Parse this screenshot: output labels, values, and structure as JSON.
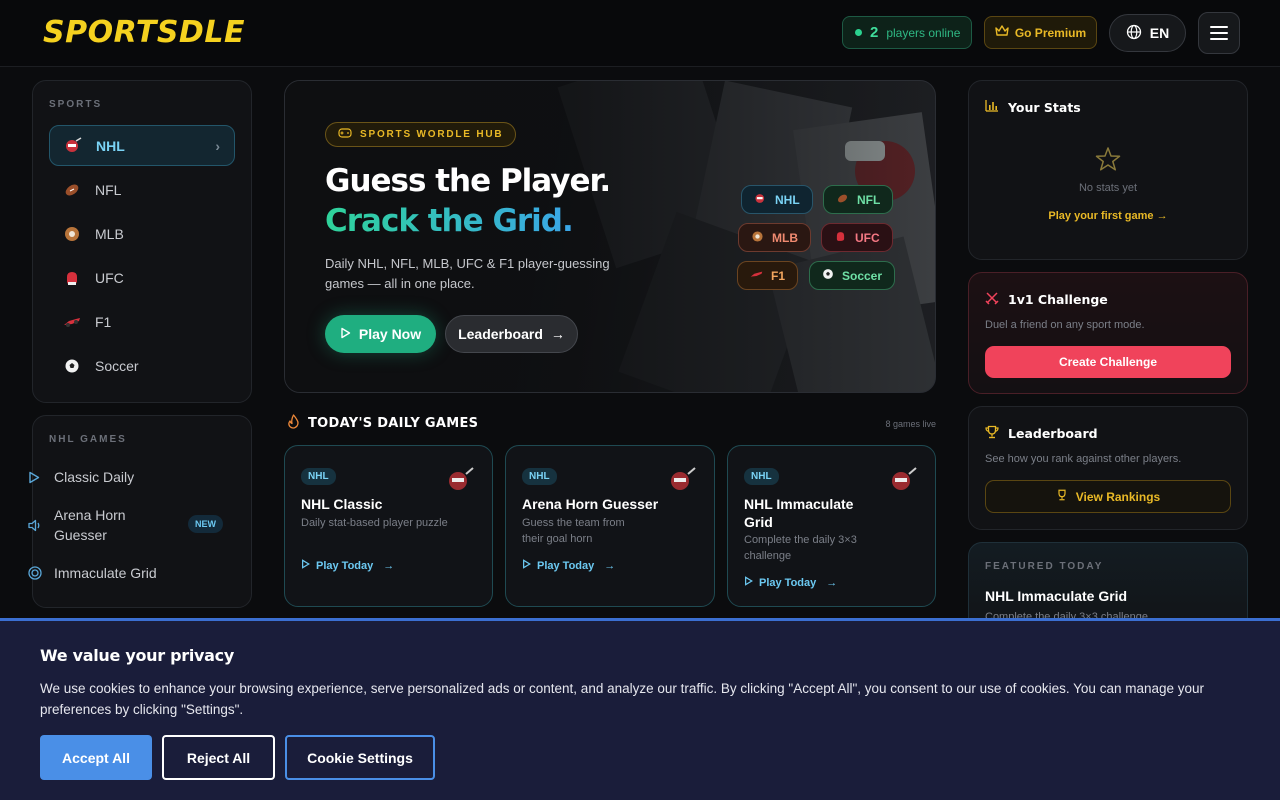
{
  "header": {
    "logo": "SPORTSDLE",
    "online_count": "2",
    "online_label": "players online",
    "premium_label": "Go Premium",
    "language": "EN"
  },
  "sidebar": {
    "sports_label": "SPORTS",
    "sports": [
      {
        "label": "NHL",
        "icon": "hockey-icon",
        "active": true
      },
      {
        "label": "NFL",
        "icon": "football-icon"
      },
      {
        "label": "MLB",
        "icon": "baseball-icon"
      },
      {
        "label": "UFC",
        "icon": "boxing-glove-icon"
      },
      {
        "label": "F1",
        "icon": "race-car-icon"
      },
      {
        "label": "Soccer",
        "icon": "soccer-ball-icon"
      }
    ],
    "games_label": "NHL GAMES",
    "games": [
      {
        "label": "Classic Daily",
        "icon": "play-icon"
      },
      {
        "label": "Arena Horn Guesser",
        "icon": "speaker-icon",
        "badge": "NEW"
      },
      {
        "label": "Immaculate Grid",
        "icon": "target-icon"
      }
    ]
  },
  "hero": {
    "badge": "SPORTS WORDLE HUB",
    "title_line1": "Guess the Player.",
    "title_line2": "Crack the Grid.",
    "subtitle": "Daily NHL, NFL, MLB, UFC & F1 player-guessing games — all in one place.",
    "play_now": "Play Now",
    "leaderboard": "Leaderboard",
    "chips": [
      "NHL",
      "NFL",
      "MLB",
      "UFC",
      "F1",
      "Soccer"
    ]
  },
  "daily": {
    "title": "TODAY'S DAILY GAMES",
    "live_count": "8 games live",
    "games": [
      {
        "tag": "NHL",
        "title": "NHL Classic",
        "desc": "Daily stat-based player puzzle",
        "cta": "Play Today"
      },
      {
        "tag": "NHL",
        "title": "Arena Horn Guesser",
        "desc": "Guess the team from their goal horn",
        "cta": "Play Today"
      },
      {
        "tag": "NHL",
        "title": "NHL Immaculate Grid",
        "desc": "Complete the daily 3×3 challenge",
        "cta": "Play Today"
      }
    ]
  },
  "stats": {
    "title": "Your Stats",
    "empty": "No stats yet",
    "cta": "Play your first game"
  },
  "challenge": {
    "title": "1v1 Challenge",
    "desc": "Duel a friend on any sport mode.",
    "button": "Create Challenge"
  },
  "leaderboard_panel": {
    "title": "Leaderboard",
    "desc": "See how you rank against other players.",
    "button": "View Rankings"
  },
  "featured": {
    "label": "FEATURED TODAY",
    "title": "NHL Immaculate Grid",
    "desc": "Complete the daily 3×3 challenge"
  },
  "cookie": {
    "title": "We value your privacy",
    "text": "We use cookies to enhance your browsing experience, serve personalized ads or content, and analyze our traffic. By clicking \"Accept All\", you consent to our use of cookies. You can manage your preferences by clicking \"Settings\".",
    "accept": "Accept All",
    "reject": "Reject All",
    "settings": "Cookie Settings"
  }
}
